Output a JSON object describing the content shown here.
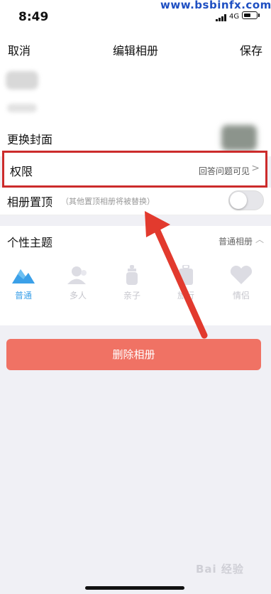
{
  "status_bar": {
    "time": "8:49",
    "network": "4G",
    "watermark": "www.bsbinfx.com"
  },
  "navbar": {
    "left_label": "取消",
    "title": "编辑相册",
    "right_label": "保存"
  },
  "settings": {
    "cover_label": "更换封面",
    "permission_label": "权限",
    "permission_value": "回答问题可见",
    "pin_label": "相册置顶",
    "pin_hint": "（其他置顶相册将被替换）",
    "pin_enabled": false
  },
  "theme": {
    "title": "个性主题",
    "current": "普通相册",
    "options": [
      {
        "label": "普通",
        "icon": "mountain-icon",
        "active": true
      },
      {
        "label": "多人",
        "icon": "person-icon",
        "active": false
      },
      {
        "label": "亲子",
        "icon": "baby-bottle-icon",
        "active": false
      },
      {
        "label": "旅行",
        "icon": "suitcase-icon",
        "active": false
      },
      {
        "label": "情侣",
        "icon": "heart-icon",
        "active": false
      }
    ]
  },
  "delete_button_label": "删除相册",
  "colors": {
    "accent": "#3ba0e8",
    "delete": "#f07264",
    "highlight_box": "#cc2b2b"
  },
  "watermark_bottom": "Bai 经验"
}
